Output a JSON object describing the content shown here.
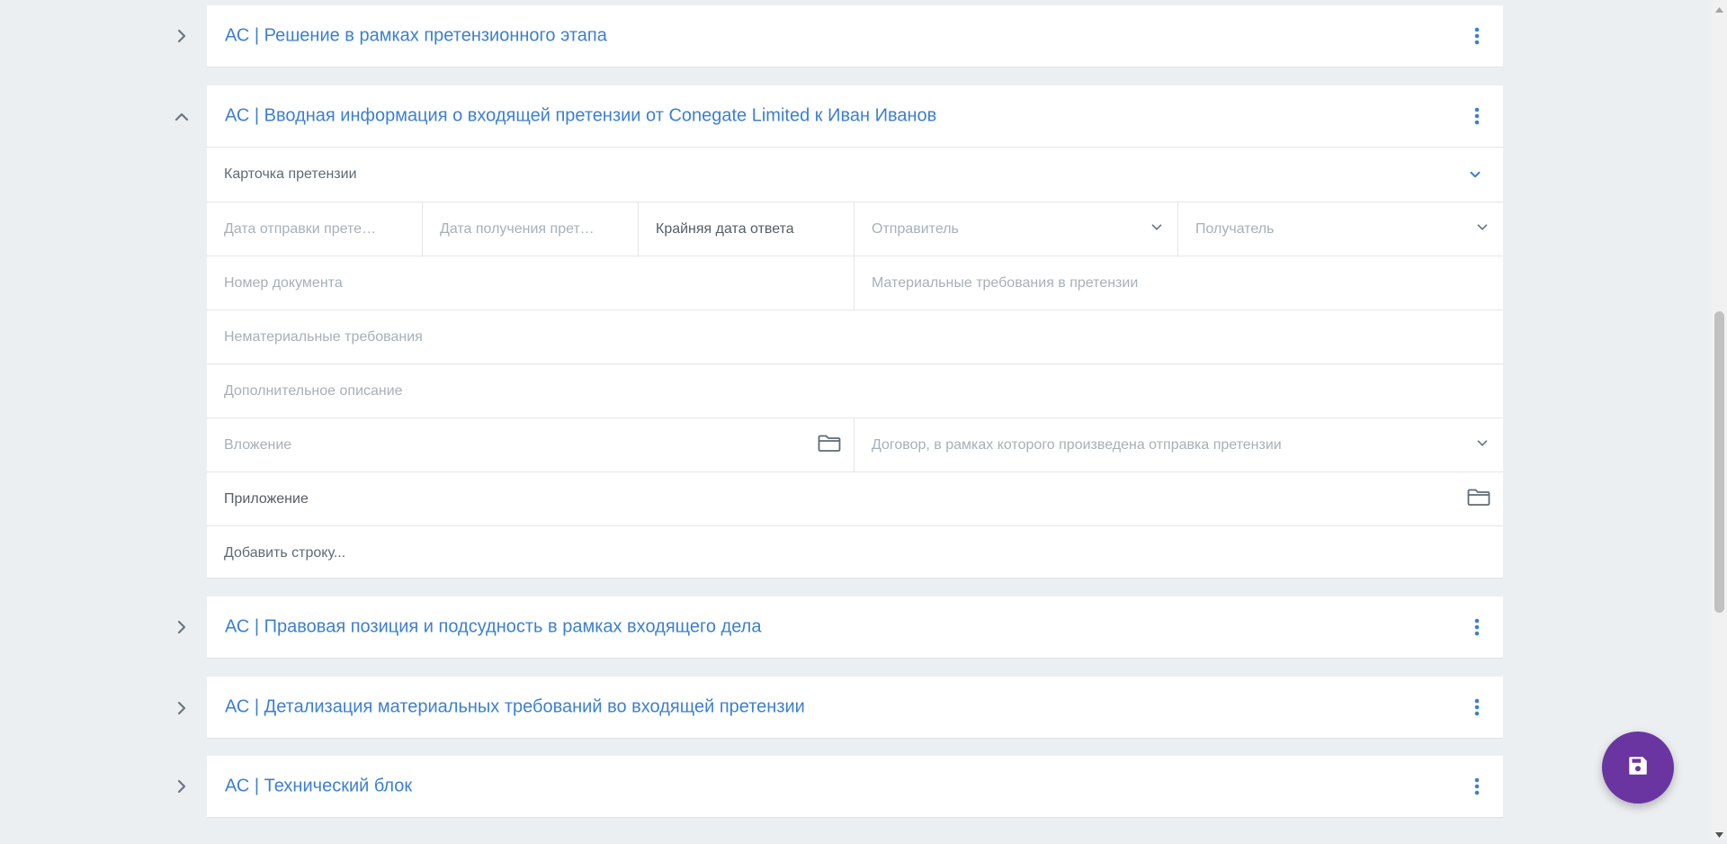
{
  "sections": [
    {
      "title": "АС | Решение в рамках претензионного этапа",
      "expanded": false
    },
    {
      "title": "АС | Вводная информация о входящей претензии от Conegate Limited к Иван Иванов",
      "expanded": true
    },
    {
      "title": "АС | Правовая позиция и подсудность в рамках входящего дела",
      "expanded": false
    },
    {
      "title": "АС | Детализация материальных требований во входящей претензии",
      "expanded": false
    },
    {
      "title": "АС | Технический блок",
      "expanded": false
    }
  ],
  "card": {
    "title": "Карточка претензии",
    "fields": {
      "send_date": "Дата отправки претензии",
      "receive_date": "Дата получения претензии",
      "deadline": "Крайняя дата ответа",
      "sender": "Отправитель",
      "recipient": "Получатель",
      "doc_number": "Номер документа",
      "material_claims": "Материальные требования в претензии",
      "nonmaterial_claims": "Нематериальные требования",
      "extra_description": "Дополнительное описание",
      "attachment": "Вложение",
      "contract": "Договор, в рамках которого произведена отправка претензии",
      "appendix": "Приложение"
    },
    "add_row": "Добавить строку..."
  },
  "icons": {
    "section_menu": "more-vertical-icon",
    "expand": "chevron-right-icon",
    "collapse": "chevron-up-icon",
    "dropdown": "chevron-down-icon",
    "folder": "folder-icon",
    "save": "save-icon"
  },
  "colors": {
    "accent": "#3d7fd1",
    "fab": "#6a35a0",
    "background": "#eceff1"
  }
}
